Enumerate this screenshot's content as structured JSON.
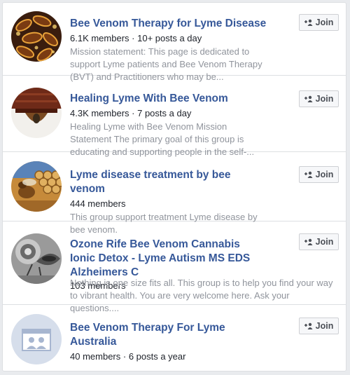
{
  "groups": [
    {
      "title": "Bee Venom Therapy for Lyme Disease",
      "members": "6.1K members",
      "activity": "10+ posts a day",
      "description": "Mission statement: This page is dedicated to support Lyme patients and Bee Venom Therapy (BVT) and Practitioners who may be...",
      "join_label": "Join"
    },
    {
      "title": "Healing Lyme With Bee Venom",
      "members": "4.3K members",
      "activity": "7 posts a day",
      "description": "Healing Lyme with Bee Venom Mission Statement The primary goal of this group is educating and supporting people in the self-...",
      "join_label": "Join"
    },
    {
      "title": "Lyme disease treatment by bee venom",
      "members": "444 members",
      "activity": "",
      "description": "This group support treatment Lyme disease by bee venom.",
      "join_label": "Join"
    },
    {
      "title": "Ozone Rife Bee Venom Cannabis Ionic Detox - Lyme Autism MS EDS Alzheimers C",
      "members": "103 members",
      "activity": "",
      "description": "Nothing is one size fits all. This group is to help you find your way to vibrant health. You are very welcome here. Ask your questions....",
      "join_label": "Join"
    },
    {
      "title": "Bee Venom Therapy For Lyme Australia",
      "members": "40 members",
      "activity": "6 posts a year",
      "description": "",
      "join_label": "Join"
    }
  ],
  "separator": " · ",
  "icons": {
    "join": "add-friend-icon",
    "default_group": "group-placeholder-icon"
  },
  "colors": {
    "link": "#365899",
    "meta_text": "#1d2129",
    "muted_text": "#90949c",
    "button_bg": "#f6f7f9",
    "border": "#dddfe2"
  }
}
